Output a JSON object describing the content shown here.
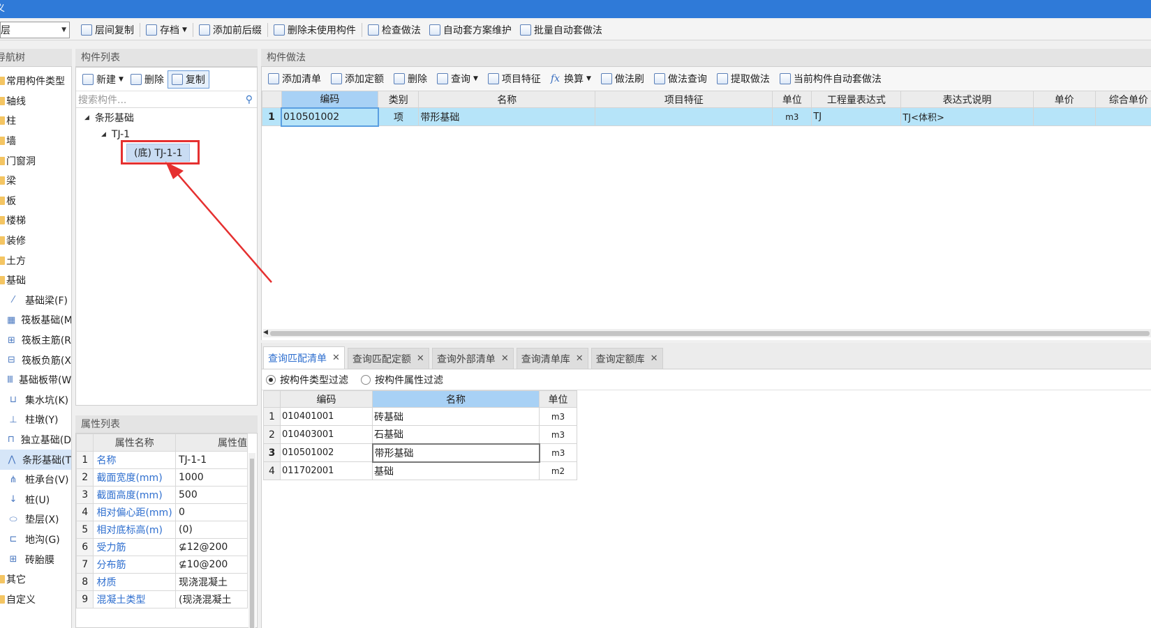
{
  "titlebar": {
    "title": "义"
  },
  "toolbar": {
    "floor": "层",
    "buttons": [
      "层间复制",
      "存档",
      "添加前后缀",
      "删除未使用构件",
      "检查做法",
      "自动套方案维护",
      "批量自动套做法"
    ]
  },
  "nav": {
    "header": "导航树",
    "items": [
      {
        "label": "常用构件类型",
        "type": "folder"
      },
      {
        "label": "轴线",
        "type": "folder"
      },
      {
        "label": "柱",
        "type": "folder"
      },
      {
        "label": "墙",
        "type": "folder"
      },
      {
        "label": "门窗洞",
        "type": "folder"
      },
      {
        "label": "梁",
        "type": "folder"
      },
      {
        "label": "板",
        "type": "folder"
      },
      {
        "label": "楼梯",
        "type": "folder"
      },
      {
        "label": "装修",
        "type": "folder"
      },
      {
        "label": "土方",
        "type": "folder"
      },
      {
        "label": "基础",
        "type": "folder"
      },
      {
        "label": "基础梁(F)",
        "type": "sub",
        "icon": "beam-icon"
      },
      {
        "label": "筏板基础(M",
        "type": "sub",
        "icon": "raft-icon"
      },
      {
        "label": "筏板主筋(R",
        "type": "sub",
        "icon": "rebar-main-icon"
      },
      {
        "label": "筏板负筋(X",
        "type": "sub",
        "icon": "rebar-neg-icon"
      },
      {
        "label": "基础板带(W",
        "type": "sub",
        "icon": "strip-band-icon"
      },
      {
        "label": "集水坑(K)",
        "type": "sub",
        "icon": "sump-icon"
      },
      {
        "label": "柱墩(Y)",
        "type": "sub",
        "icon": "pier-icon"
      },
      {
        "label": "独立基础(D",
        "type": "sub",
        "icon": "isolated-footing-icon"
      },
      {
        "label": "条形基础(T",
        "type": "sub",
        "icon": "strip-footing-icon",
        "active": true
      },
      {
        "label": "桩承台(V)",
        "type": "sub",
        "icon": "pile-cap-icon"
      },
      {
        "label": "桩(U)",
        "type": "sub",
        "icon": "pile-icon"
      },
      {
        "label": "垫层(X)",
        "type": "sub",
        "icon": "cushion-icon"
      },
      {
        "label": "地沟(G)",
        "type": "sub",
        "icon": "trench-icon"
      },
      {
        "label": "砖胎膜",
        "type": "sub",
        "icon": "brick-mold-icon"
      },
      {
        "label": "其它",
        "type": "folder"
      },
      {
        "label": "自定义",
        "type": "folder"
      }
    ]
  },
  "complist": {
    "header": "构件列表",
    "new_label": "新建",
    "delete_label": "删除",
    "copy_label": "复制",
    "search_placeholder": "搜索构件...",
    "tree_root": "条形基础",
    "tree_child": "TJ-1",
    "tree_leaf": "(底) TJ-1-1"
  },
  "proplist": {
    "header": "属性列表",
    "col_name": "属性名称",
    "col_value": "属性值",
    "rows": [
      {
        "idx": "1",
        "name": "名称",
        "value": "TJ-1-1"
      },
      {
        "idx": "2",
        "name": "截面宽度(mm)",
        "value": "1000"
      },
      {
        "idx": "3",
        "name": "截面高度(mm)",
        "value": "500"
      },
      {
        "idx": "4",
        "name": "相对偏心距(mm)",
        "value": "0"
      },
      {
        "idx": "5",
        "name": "相对底标高(m)",
        "value": "(0)"
      },
      {
        "idx": "6",
        "name": "受力筋",
        "value": "⊈12@200"
      },
      {
        "idx": "7",
        "name": "分布筋",
        "value": "⊈10@200"
      },
      {
        "idx": "8",
        "name": "材质",
        "value": "现浇混凝土"
      },
      {
        "idx": "9",
        "name": "混凝土类型",
        "value": "(现浇混凝土"
      }
    ]
  },
  "method": {
    "header": "构件做法",
    "buttons": [
      "添加清单",
      "添加定额",
      "删除",
      "查询",
      "项目特征",
      "换算",
      "做法刷",
      "做法查询",
      "提取做法",
      "当前构件自动套做法"
    ],
    "columns": [
      "编码",
      "类别",
      "名称",
      "项目特征",
      "单位",
      "工程量表达式",
      "表达式说明",
      "单价",
      "综合单价"
    ],
    "rows": [
      {
        "idx": "1",
        "code": "010501002",
        "cat": "项",
        "name": "带形基础",
        "feature": "",
        "unit": "m3",
        "expr": "TJ",
        "expr_desc": "TJ<体积>",
        "price": "",
        "total": ""
      }
    ]
  },
  "query": {
    "tabs": [
      "查询匹配清单",
      "查询匹配定额",
      "查询外部清单",
      "查询清单库",
      "查询定额库"
    ],
    "filter_type": "按构件类型过滤",
    "filter_attr": "按构件属性过滤",
    "columns": [
      "编码",
      "名称",
      "单位"
    ],
    "rows": [
      {
        "idx": "1",
        "code": "010401001",
        "name": "砖基础",
        "unit": "m3"
      },
      {
        "idx": "2",
        "code": "010403001",
        "name": "石基础",
        "unit": "m3"
      },
      {
        "idx": "3",
        "code": "010501002",
        "name": "带形基础",
        "unit": "m3"
      },
      {
        "idx": "4",
        "code": "011702001",
        "name": "基础",
        "unit": "m2"
      }
    ]
  },
  "colors": {
    "titlebar": "#2f7ad8",
    "selected_row": "#b6e4f9",
    "annotation": "#e53030",
    "link_text": "#2f6fcf"
  }
}
